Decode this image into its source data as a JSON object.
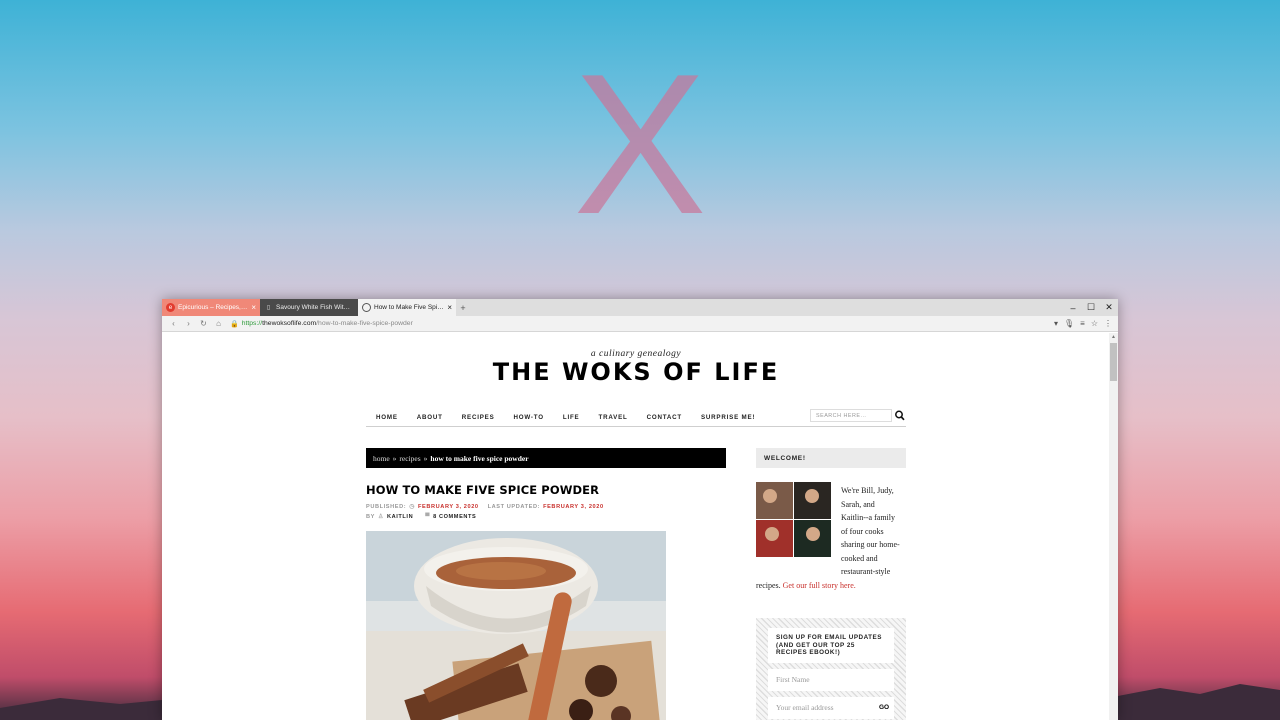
{
  "desktop": {
    "logo_glyph": "X"
  },
  "browser": {
    "tabs": [
      {
        "title": "Epicurious – Recipes, Me...",
        "active": false
      },
      {
        "title": "Savoury White Fish With...",
        "active": false
      },
      {
        "title": "How to Make Five Spice...",
        "active": true
      }
    ],
    "new_tab": "+",
    "window_controls": {
      "minimize": "–",
      "maximize": "☐",
      "close": "✕"
    },
    "toolbar": {
      "back": "‹",
      "forward": "›",
      "reload": "↻",
      "home": "⌂"
    },
    "url": {
      "scheme": "https://",
      "host": "thewoksoflife.com",
      "path": "/how-to-make-five-spice-powder"
    },
    "toolbar_right": {
      "mic": "🎙",
      "reader": "≡",
      "star": "☆",
      "menu": "⋮",
      "dropdown": "▾"
    }
  },
  "site": {
    "tagline": "a culinary genealogy",
    "title": "THE WOKS OF LIFE",
    "nav": [
      "HOME",
      "ABOUT",
      "RECIPES",
      "HOW-TO",
      "LIFE",
      "TRAVEL",
      "CONTACT",
      "SURPRISE ME!"
    ],
    "search_placeholder": "SEARCH HERE..."
  },
  "breadcrumb": {
    "home": "home",
    "sep": "»",
    "recipes": "recipes",
    "current": "how to make five spice powder"
  },
  "post": {
    "title": "HOW TO MAKE FIVE SPICE POWDER",
    "published_label": "PUBLISHED:",
    "published_date": "FEBRUARY 3, 2020",
    "updated_label": "LAST UPDATED:",
    "updated_date": "FEBRUARY 3, 2020",
    "by_label": "BY",
    "author": "KAITLIN",
    "comments": "8 COMMENTS"
  },
  "sidebar": {
    "welcome_title": "WELCOME!",
    "welcome_lines": [
      "We're Bill, Judy,",
      "Sarah, and",
      "Kaitlin--a family",
      "of four cooks",
      "sharing our home-",
      "cooked and",
      "restaurant-style"
    ],
    "welcome_last": "recipes.",
    "welcome_link": "Get our full story here.",
    "signup_title": "SIGN UP FOR EMAIL UPDATES (AND GET OUR TOP 25 RECIPES EBOOK!)",
    "first_name_placeholder": "First Name",
    "email_placeholder": "Your email address",
    "go_label": "GO"
  }
}
